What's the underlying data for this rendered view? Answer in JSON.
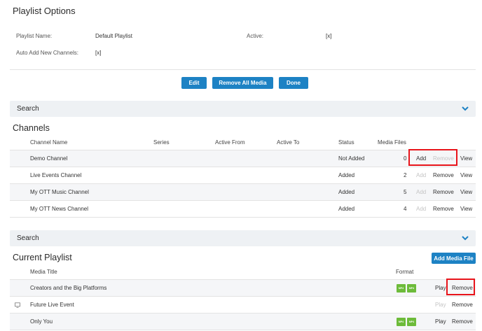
{
  "options": {
    "title": "Playlist Options",
    "playlist_name_label": "Playlist Name:",
    "playlist_name_value": "Default Playlist",
    "active_label": "Active:",
    "active_value": "[x]",
    "auto_add_label": "Auto Add New Channels:",
    "auto_add_value": "[x]"
  },
  "buttons": {
    "edit": "Edit",
    "remove_all": "Remove All Media",
    "done": "Done",
    "add_media": "Add Media File"
  },
  "search1": {
    "label": "Search"
  },
  "search2": {
    "label": "Search"
  },
  "channels": {
    "title": "Channels",
    "headers": {
      "name": "Channel Name",
      "series": "Series",
      "active_from": "Active From",
      "active_to": "Active To",
      "status": "Status",
      "media_files": "Media Files"
    },
    "rows": [
      {
        "name": "Demo Channel",
        "status": "Not Added",
        "media_files": "0",
        "add": "Add",
        "remove": "Remove",
        "view": "View",
        "add_enabled": true,
        "remove_enabled": false
      },
      {
        "name": "Live Events Channel",
        "status": "Added",
        "media_files": "2",
        "add": "Add",
        "remove": "Remove",
        "view": "View",
        "add_enabled": false,
        "remove_enabled": true
      },
      {
        "name": "My OTT Music Channel",
        "status": "Added",
        "media_files": "5",
        "add": "Add",
        "remove": "Remove",
        "view": "View",
        "add_enabled": false,
        "remove_enabled": true
      },
      {
        "name": "My OTT News Channel",
        "status": "Added",
        "media_files": "4",
        "add": "Add",
        "remove": "Remove",
        "view": "View",
        "add_enabled": false,
        "remove_enabled": true
      }
    ]
  },
  "playlist": {
    "title": "Current Playlist",
    "headers": {
      "media_title": "Media Title",
      "format": "Format"
    },
    "format_badge": "MP4",
    "rows": [
      {
        "title": "Creators and the Big Platforms",
        "play": "Play",
        "remove": "Remove",
        "play_enabled": true,
        "has_formats": true,
        "live": false
      },
      {
        "title": "Future Live Event",
        "play": "Play",
        "remove": "Remove",
        "play_enabled": false,
        "has_formats": false,
        "live": true
      },
      {
        "title": "Only You",
        "play": "Play",
        "remove": "Remove",
        "play_enabled": true,
        "has_formats": true,
        "live": false
      }
    ]
  },
  "colors": {
    "accent": "#1d82c4",
    "highlight": "#e8141b",
    "format_badge": "#6dbb3a",
    "disabled": "#c5c5c5"
  }
}
